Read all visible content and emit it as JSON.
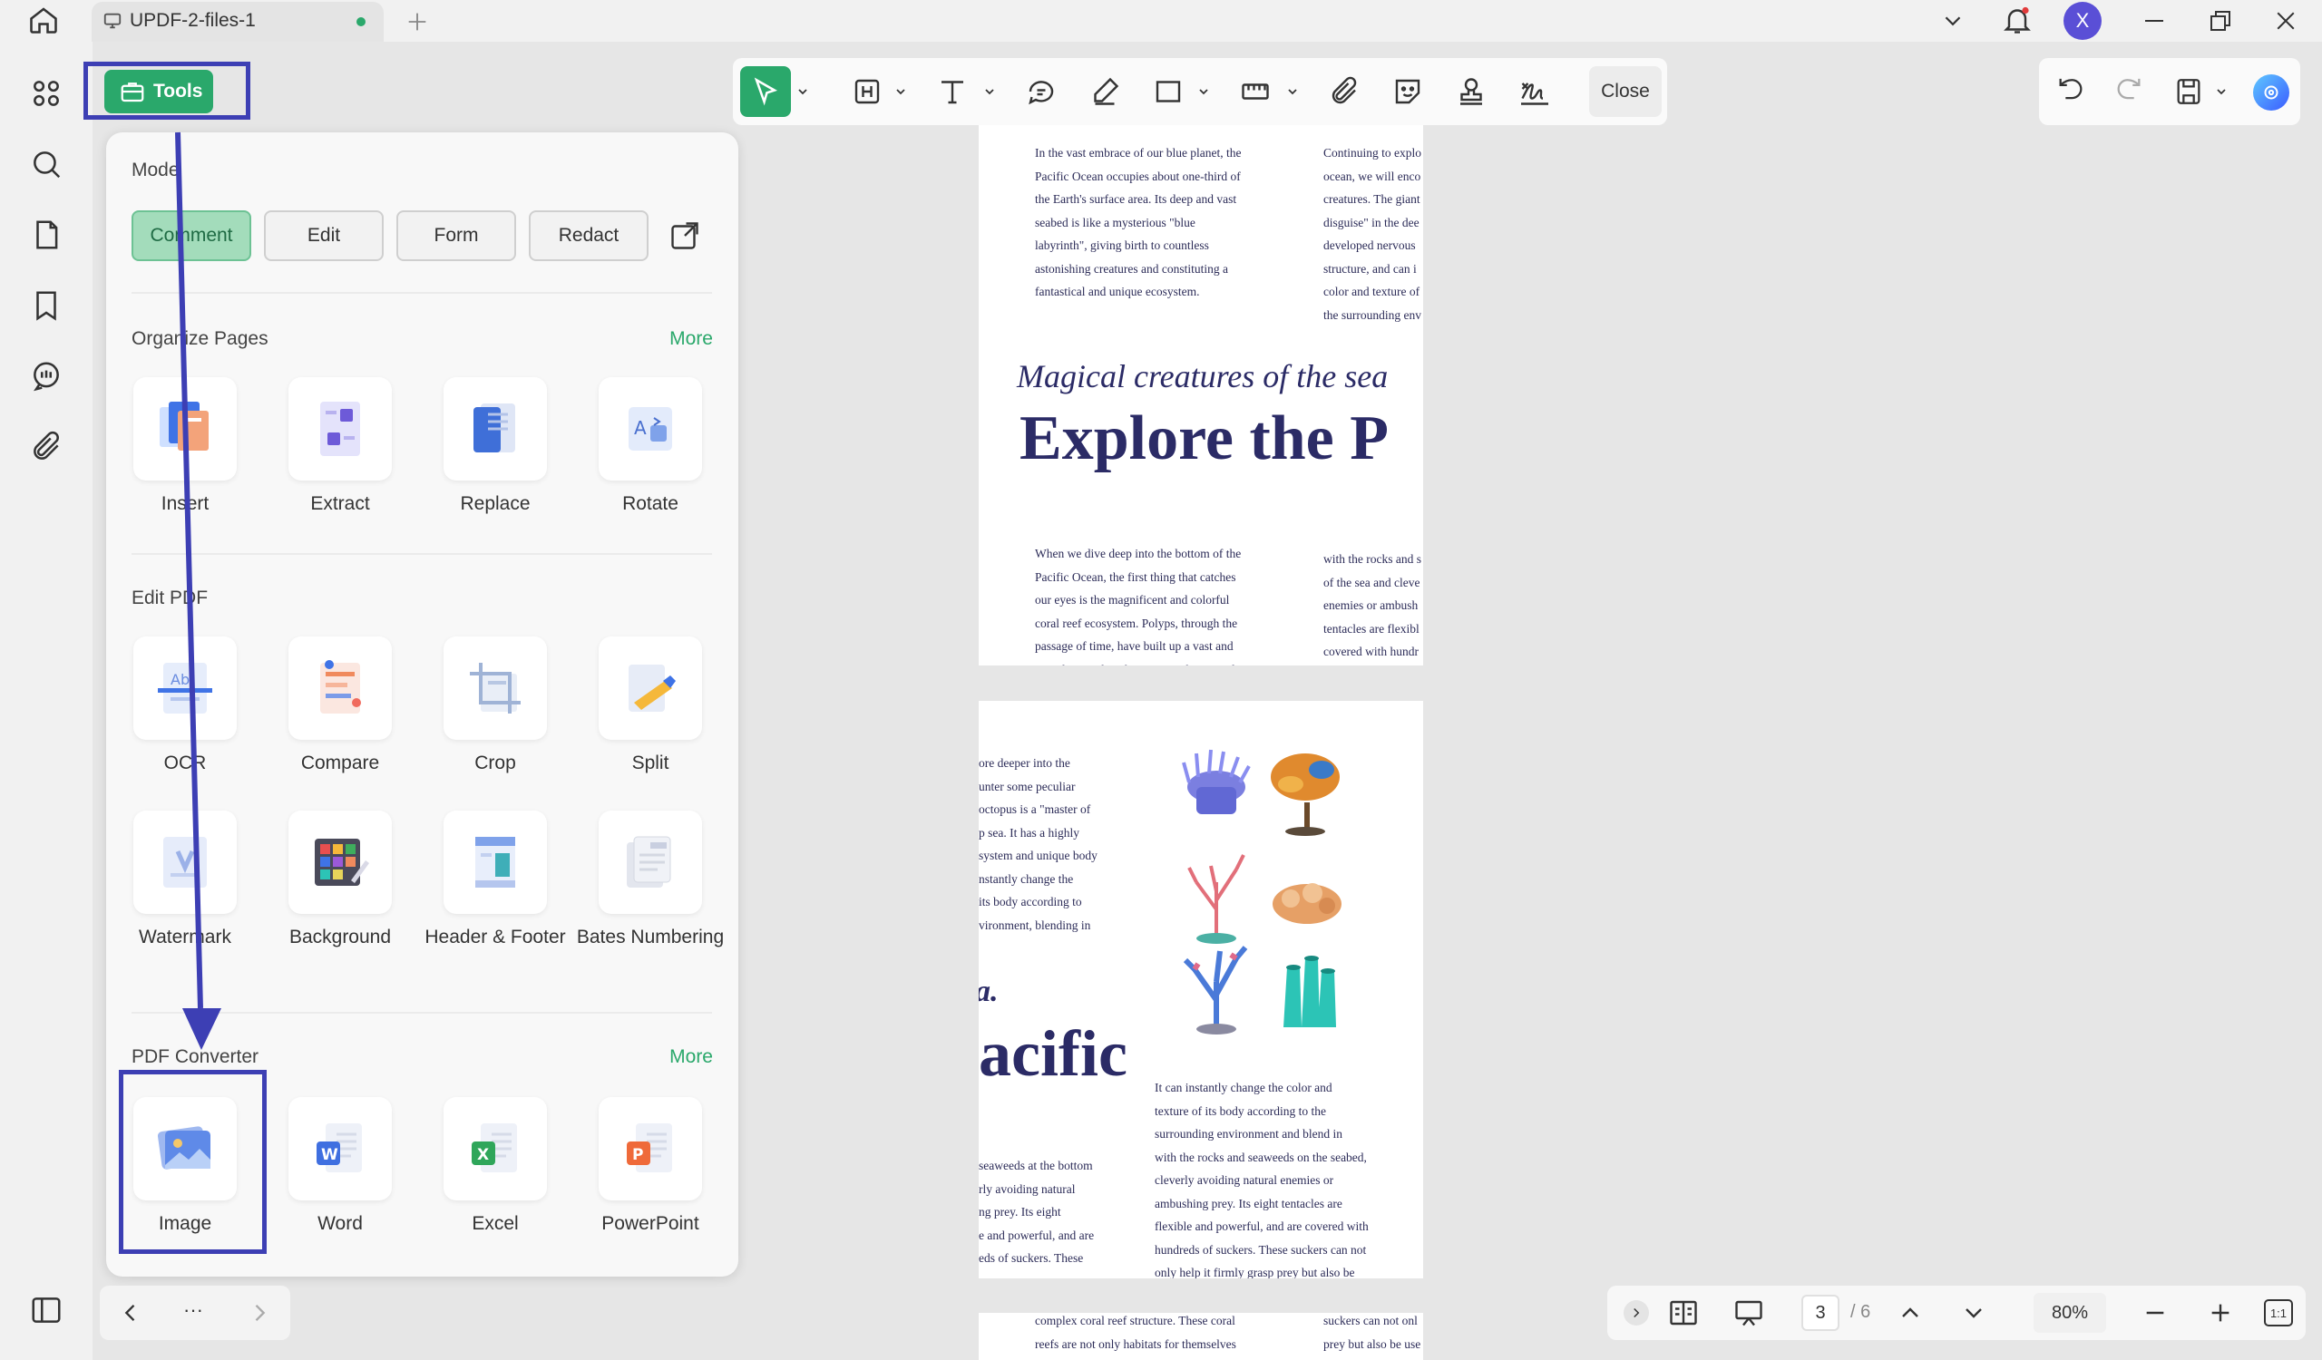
{
  "app": {
    "tab_title": "UPDF-2-files-1",
    "user_initial": "X"
  },
  "tools_button": {
    "label": "Tools"
  },
  "toolbar": {
    "close_label": "Close"
  },
  "panel": {
    "mode_title": "Mode",
    "modes": [
      "Comment",
      "Edit",
      "Form",
      "Redact"
    ],
    "organize": {
      "title": "Organize Pages",
      "more": "More",
      "items": [
        "Insert",
        "Extract",
        "Replace",
        "Rotate"
      ]
    },
    "edit_pdf": {
      "title": "Edit PDF",
      "items": [
        "OCR",
        "Compare",
        "Crop",
        "Split",
        "Watermark",
        "Background",
        "Header & Footer",
        "Bates Numbering"
      ]
    },
    "converter": {
      "title": "PDF Converter",
      "more": "More",
      "items": [
        "Image",
        "Word",
        "Excel",
        "PowerPoint"
      ]
    }
  },
  "document": {
    "page1": {
      "col1": [
        "In the vast embrace of our blue planet, the",
        "Pacific Ocean occupies about one-third of",
        "the Earth's surface area. Its deep and vast",
        "seabed is like a mysterious \"blue",
        "labyrinth\", giving birth to countless",
        "astonishing creatures and constituting a",
        "fantastical and unique ecosystem."
      ],
      "col2": [
        "Continuing to explo",
        "ocean, we will enco",
        "creatures. The giant",
        "disguise\" in the dee",
        "developed nervous",
        "structure, and can i",
        "color and texture of",
        "the surrounding env"
      ],
      "subtitle": "Magical creatures of the sea",
      "title": "Explore the P",
      "col3": [
        "When we dive deep into the bottom of the",
        "Pacific Ocean, the first thing that catches",
        "our eyes is the magnificent and colorful",
        "coral reef ecosystem. Polyps, through the",
        "passage of time, have built up a vast and",
        "complex coral reef structure. These coral"
      ],
      "col4": [
        "with the rocks and s",
        "of the sea and cleve",
        "enemies or ambush",
        "tentacles are flexibl",
        "covered with hundr"
      ]
    },
    "page2": {
      "col1": [
        "ore deeper into the",
        "unter some peculiar",
        "octopus is a \"master of",
        "p sea. It has a highly",
        "system and unique body",
        "nstantly change the",
        "its body according to",
        "vironment, blending in"
      ],
      "frag": "a.",
      "big": "acific",
      "col2": [
        "It can instantly change the color and",
        "texture of its body according to the",
        "surrounding environment and blend in",
        "with the rocks and seaweeds on the seabed,",
        "cleverly avoiding natural enemies or",
        "ambushing prey. Its eight tentacles are",
        "flexible and powerful, and are covered with",
        "hundreds of suckers. These suckers can not",
        "only help it firmly grasp prey but also be"
      ],
      "col3": [
        "seaweeds at the bottom",
        "rly avoiding natural",
        "ng prey. Its eight",
        "e and powerful, and are",
        "eds of suckers. These"
      ]
    },
    "page3": {
      "col1": [
        "complex coral reef structure. These coral",
        "reefs are not only habitats for themselves"
      ],
      "col2": [
        "suckers can not onl",
        "prey but also be use"
      ]
    }
  },
  "panel_nav": {
    "ellipsis": "···"
  },
  "status": {
    "current_page": "3",
    "total_pages": "/ 6",
    "zoom": "80%",
    "fit": "1:1"
  },
  "colors": {
    "accent": "#2aa86b",
    "highlight": "#3d3fb4",
    "doc_text": "#2b2b66"
  }
}
